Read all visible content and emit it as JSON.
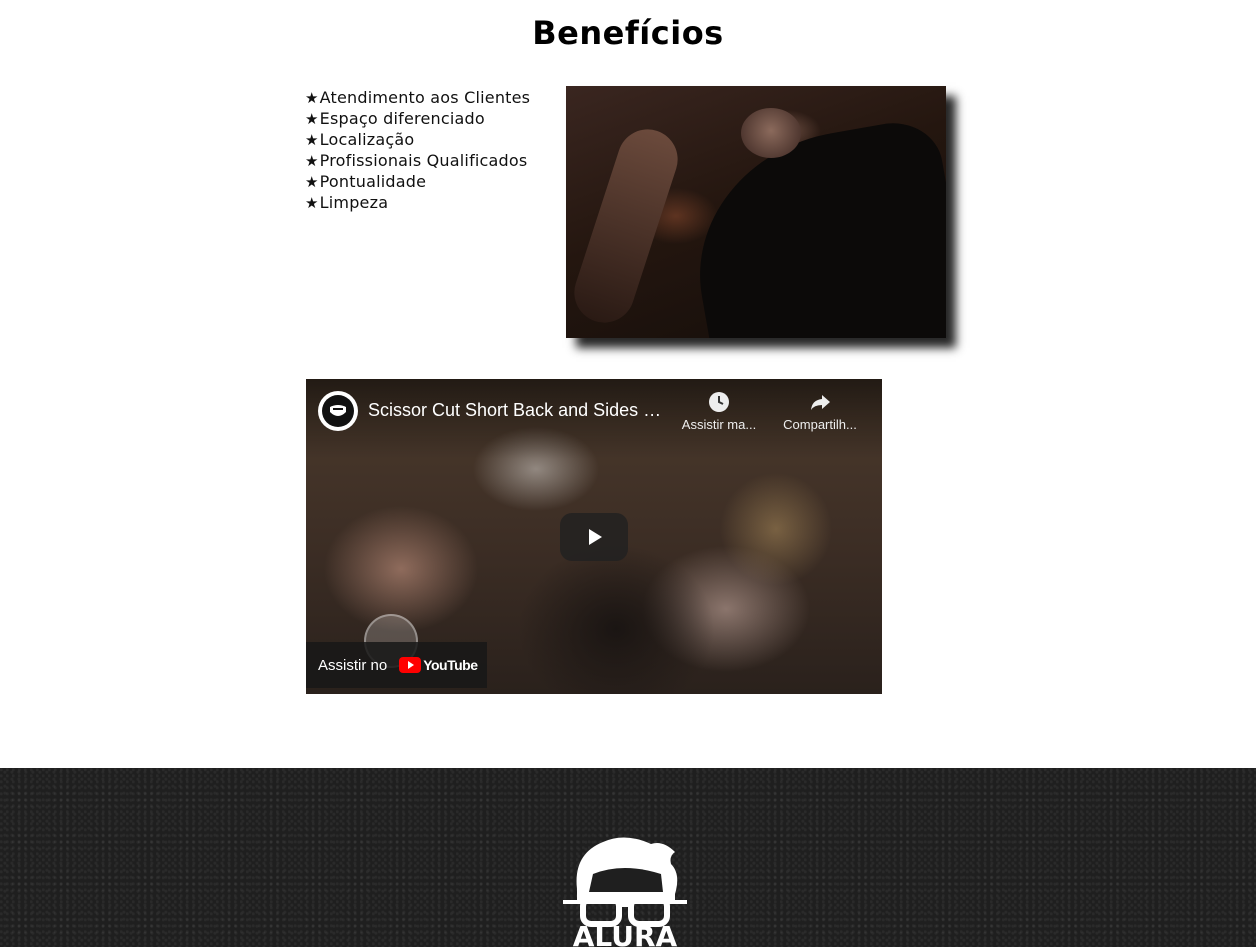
{
  "section": {
    "title": "Benefícios"
  },
  "benefits": {
    "star": "★",
    "items": [
      "Atendimento aos Clientes",
      "Espaço diferenciado",
      "Localização",
      "Profissionais Qualificados",
      "Pontualidade",
      "Limpeza"
    ]
  },
  "video": {
    "title": "Scissor Cut Short Back and Sides M...",
    "watch_later": "Assistir ma...",
    "share": "Compartilh...",
    "watch_on": "Assistir no",
    "youtube": "YouTube"
  },
  "footer": {
    "logo_text": "ALURA"
  },
  "colors": {
    "footer_bg": "#1f1f1f",
    "youtube_red": "#ff0000"
  }
}
